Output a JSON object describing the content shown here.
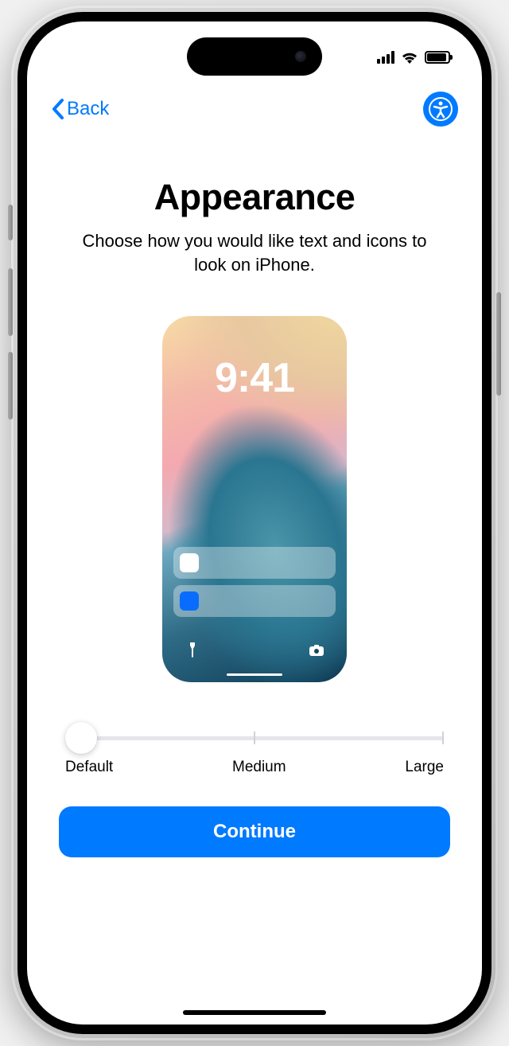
{
  "nav": {
    "back_label": "Back"
  },
  "header": {
    "title": "Appearance",
    "subtitle": "Choose how you would like text and icons to look on iPhone."
  },
  "preview": {
    "time": "9:41"
  },
  "slider": {
    "labels": {
      "default": "Default",
      "medium": "Medium",
      "large": "Large"
    }
  },
  "actions": {
    "continue_label": "Continue"
  }
}
